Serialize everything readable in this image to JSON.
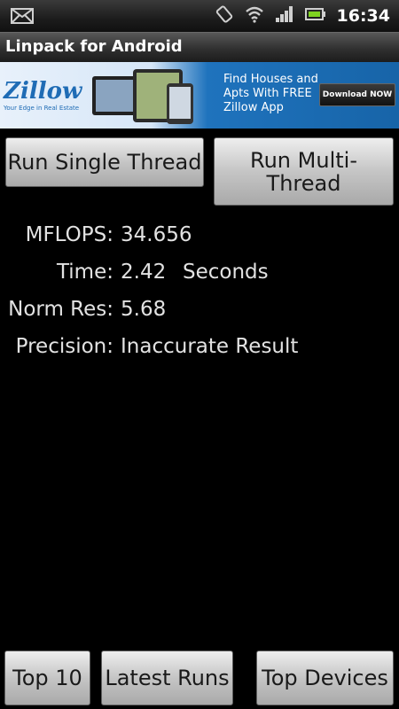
{
  "status_bar": {
    "clock": "16:34",
    "icons": [
      "email-icon",
      "rotate-icon",
      "wifi-icon",
      "signal-icon",
      "battery-icon"
    ]
  },
  "app": {
    "title": "Linpack for Android"
  },
  "ad": {
    "logo_text": "Zillow",
    "tagline": "Your Edge in Real Estate",
    "headline": "Find Houses and Apts With FREE Zillow App",
    "cta": "Download NOW"
  },
  "buttons": {
    "single": "Run Single Thread",
    "multi": "Run Multi-Thread",
    "top10": "Top 10",
    "latest": "Latest Runs",
    "devices": "Top Devices"
  },
  "results": {
    "mflops_label": "MFLOPS:",
    "mflops": "34.656",
    "time_label": "Time:",
    "time": "2.42",
    "time_unit": "Seconds",
    "normres_label": "Norm Res:",
    "normres": "5.68",
    "precision_label": "Precision:",
    "precision": "Inaccurate Result"
  }
}
